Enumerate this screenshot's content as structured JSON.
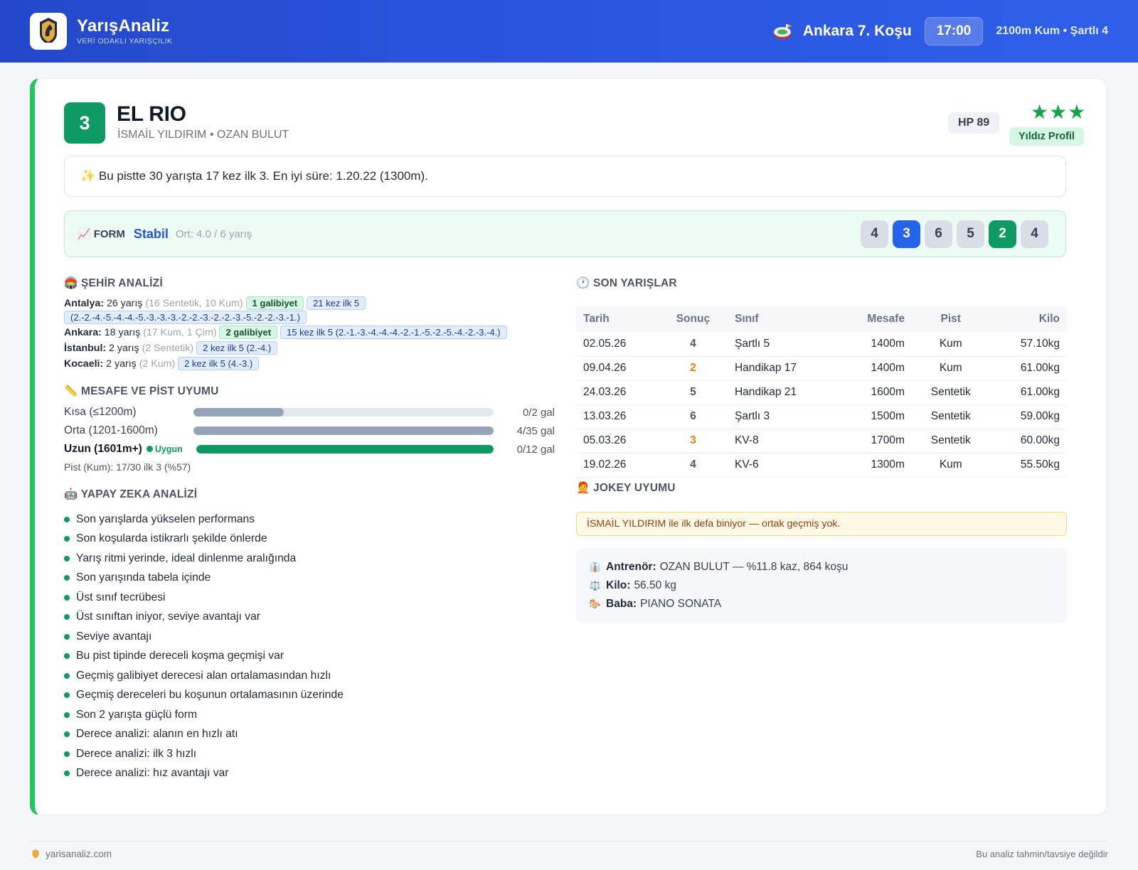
{
  "header": {
    "brand_name": "YarışAnaliz",
    "brand_tagline": "VERİ ODAKLI YARIŞÇILIK",
    "logo_text": "YARIŞ ANALİZ",
    "race_title": "Ankara 7. Koşu",
    "race_time": "17:00",
    "race_meta": "2100m Kum • Şartlı 4"
  },
  "horse": {
    "number": "3",
    "name": "EL RIO",
    "jockey_trainer": "İSMAİL YILDIRIM • OZAN BULUT",
    "hp": "HP 89",
    "stars": "★★★",
    "profile_badge": "Yıldız Profil"
  },
  "highlight": "✨ Bu pistte 30 yarışta 17 kez ilk 3. En iyi süre: 1.20.22 (1300m).",
  "form": {
    "icon": "📈",
    "label": "FORM",
    "status": "Stabil",
    "average": "Ort: 4.0 / 6 yarış",
    "results": [
      "4",
      "3",
      "6",
      "5",
      "2",
      "4"
    ]
  },
  "city_analysis": {
    "title": "🏟️ ŞEHİR ANALİZİ",
    "cities": [
      {
        "name": "Antalya:",
        "races": "26 yarış",
        "detail": "(16 Sentetik, 10 Kum)",
        "wins": "1 galibiyet",
        "top5": "21 kez ilk 5",
        "top5_seq": "(2.-2.-4.-5.-4.-4.-5.-3.-3.-3.-2.-2.-3.-2.-2.-3.-5.-2.-2.-3.-1.)"
      },
      {
        "name": "Ankara:",
        "races": "18 yarış",
        "detail": "(17 Kum, 1 Çim)",
        "wins": "2 galibiyet",
        "top5": "15 kez ilk 5 (2.-1.-3.-4.-4.-4.-2.-1.-5.-2.-5.-4.-2.-3.-4.)"
      },
      {
        "name": "İstanbul:",
        "races": "2 yarış",
        "detail": "(2 Sentetik)",
        "top5": "2 kez ilk 5 (2.-4.)"
      },
      {
        "name": "Kocaeli:",
        "races": "2 yarış",
        "detail": "(2 Kum)",
        "top5": "2 kez ilk 5 (4.-3.)"
      }
    ]
  },
  "distance": {
    "title": "📏 MESAFE VE PİST UYUMU",
    "rows": [
      {
        "label": "Kısa (≤1200m)",
        "value": "0/2 gal",
        "fill": 0.3
      },
      {
        "label": "Orta (1201-1600m)",
        "value": "4/35 gal",
        "fill": 1.0
      },
      {
        "label": "Uzun (1601m+)",
        "value": "0/12 gal",
        "fill": 1.0,
        "badge": "Uygun"
      }
    ],
    "pist": "Pist (Kum): 17/30 ilk 3 (%57)"
  },
  "ai": {
    "title": "🤖 YAPAY ZEKA ANALİZİ",
    "items": [
      "Son yarışlarda yükselen performans",
      "Son koşularda istikrarlı şekilde önlerde",
      "Yarış ritmi yerinde, ideal dinlenme aralığında",
      "Son yarışında tabela içinde",
      "Üst sınıf tecrübesi",
      "Üst sınıftan iniyor, seviye avantajı var",
      "Seviye avantajı",
      "Bu pist tipinde dereceli koşma geçmişi var",
      "Geçmiş galibiyet derecesi alan ortalamasından hızlı",
      "Geçmiş dereceleri bu koşunun ortalamasının üzerinde",
      "Son 2 yarışta güçlü form",
      "Derece analizi: alanın en hızlı atı",
      "Derece analizi: ilk 3 hızlı",
      "Derece analizi: hız avantajı var"
    ]
  },
  "recent_races": {
    "title": "🕐 SON YARIŞLAR",
    "columns": [
      "Tarih",
      "Sonuç",
      "Sınıf",
      "Mesafe",
      "Pist",
      "Kilo"
    ],
    "rows": [
      {
        "date": "02.05.26",
        "result": "4",
        "class": "Şartlı 5",
        "distance": "1400m",
        "track": "Kum",
        "weight": "57.10kg",
        "result_color": "#4b5563"
      },
      {
        "date": "09.04.26",
        "result": "2",
        "class": "Handikap 17",
        "distance": "1400m",
        "track": "Kum",
        "weight": "61.00kg",
        "result_color": "#ea7a0c"
      },
      {
        "date": "24.03.26",
        "result": "5",
        "class": "Handikap 21",
        "distance": "1600m",
        "track": "Sentetik",
        "weight": "61.00kg",
        "result_color": "#4b5563"
      },
      {
        "date": "13.03.26",
        "result": "6",
        "class": "Şartlı 3",
        "distance": "1500m",
        "track": "Sentetik",
        "weight": "59.00kg",
        "result_color": "#4b5563"
      },
      {
        "date": "05.03.26",
        "result": "3",
        "class": "KV-8",
        "distance": "1700m",
        "track": "Sentetik",
        "weight": "60.00kg",
        "result_color": "#ea7a0c"
      },
      {
        "date": "19.02.26",
        "result": "4",
        "class": "KV-6",
        "distance": "1300m",
        "track": "Kum",
        "weight": "55.50kg",
        "result_color": "#4b5563"
      }
    ]
  },
  "jockey": {
    "title": "🧑‍🦰 JOKEY UYUMU",
    "note": "İSMAİL YILDIRIM ile ilk defa biniyor — ortak geçmiş yok."
  },
  "info": {
    "trainer_icon": "👔",
    "trainer_label": "Antrenör:",
    "trainer_value": "OZAN BULUT — %11.8 kaz, 864 koşu",
    "weight_icon": "⚖️",
    "weight_label": "Kilo:",
    "weight_value": "56.50 kg",
    "sire_icon": "🐎",
    "sire_label": "Baba:",
    "sire_value": "PIANO SONATA"
  },
  "footer": {
    "site": "yarisanaliz.com",
    "disclaimer": "Bu analiz tahmin/tavsiye değildir"
  },
  "colors": {
    "header_blue": "#2b55e0",
    "accent_green": "#0f9a64",
    "form_blue": "#2563eb",
    "result_orange": "#ea7a0c"
  }
}
